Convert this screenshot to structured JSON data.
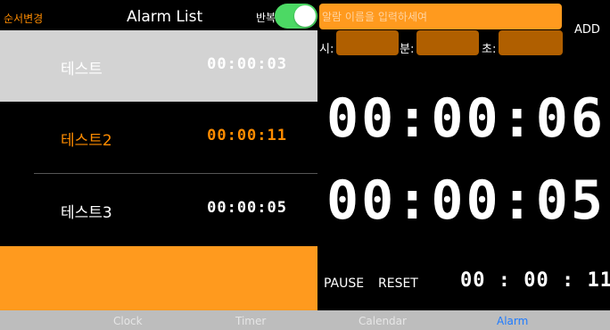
{
  "header": {
    "reorder_label": "순서변경",
    "title": "Alarm List",
    "repeat_label": "반복",
    "repeat_on": true
  },
  "alarms": [
    {
      "name": "테스트",
      "time": "00:00:03"
    },
    {
      "name": "테스트2",
      "time": "00:00:11"
    },
    {
      "name": "테스트3",
      "time": "00:00:05"
    }
  ],
  "form": {
    "name_placeholder": "알람 이름을 입력하세여",
    "add_label": "ADD",
    "hour_label": "시:",
    "minute_label": "분:",
    "second_label": "초:"
  },
  "display": {
    "time_1": "00:00:06",
    "time_2": "00:00:05",
    "small_time": "00 : 00 : 11"
  },
  "controls": {
    "pause_label": "PAUSE",
    "reset_label": "RESET"
  },
  "tabs": [
    {
      "label": "Clock"
    },
    {
      "label": "Timer"
    },
    {
      "label": "Calendar"
    },
    {
      "label": "Alarm",
      "active": true
    }
  ],
  "colors": {
    "accent": "#ff8c00",
    "toggle_on": "#4cd964",
    "active_tab": "#1e7bff"
  }
}
